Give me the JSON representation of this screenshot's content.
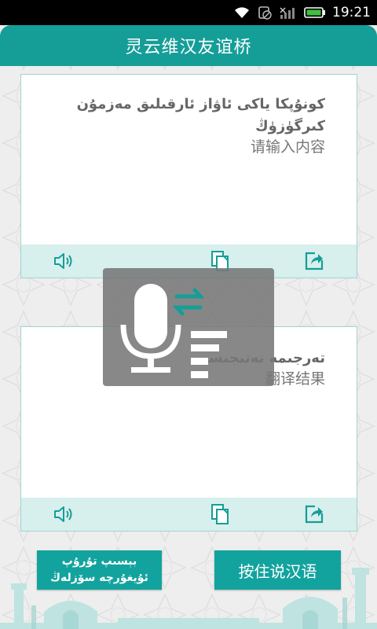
{
  "status_bar": {
    "time": "19:21",
    "icons": [
      "wifi-icon",
      "sim-blocked-icon",
      "signal-icon",
      "battery-icon"
    ]
  },
  "app": {
    "title": "灵云维汉友谊桥"
  },
  "input_panel": {
    "uyghur_hint_line1": "كونۇپكا ياكى ئاۋاز ئارقىلىق مەزمۇن",
    "uyghur_hint_line2": "كىرگۈزۈڭ",
    "chinese_hint": "请输入内容",
    "tools": [
      "speaker-icon",
      "copy-icon",
      "share-icon"
    ]
  },
  "output_panel": {
    "uyghur_hint": "تەرجىمە نەتىجىسى",
    "chinese_hint": "翻译结果",
    "tools": [
      "speaker-icon",
      "copy-icon",
      "share-icon"
    ]
  },
  "voice_overlay": {
    "icons": [
      "microphone-icon",
      "swap-arrows-icon",
      "text-lines-icon"
    ]
  },
  "buttons": {
    "uyghur_line1": "بېسىپ تۇرۇپ",
    "uyghur_line2": "ئۇيغۇرچە سۆزلەڭ",
    "chinese": "按住说汉语"
  },
  "colors": {
    "accent": "#159e98",
    "toolbar_bg": "#d7efed",
    "overlay": "#787878"
  }
}
